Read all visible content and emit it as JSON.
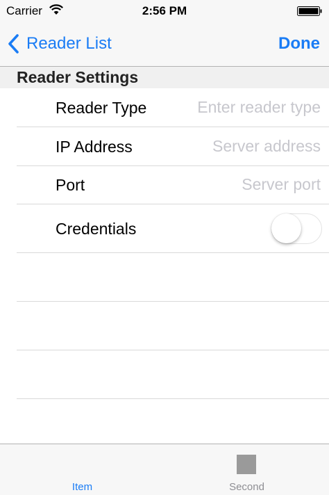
{
  "status_bar": {
    "carrier": "Carrier",
    "time": "2:56 PM"
  },
  "nav": {
    "back_label": "Reader List",
    "done_label": "Done"
  },
  "section": {
    "title": "Reader Settings"
  },
  "form": {
    "reader_type": {
      "label": "Reader Type",
      "value": "",
      "placeholder": "Enter reader type"
    },
    "ip_address": {
      "label": "IP Address",
      "value": "",
      "placeholder": "Server address"
    },
    "port": {
      "label": "Port",
      "value": "",
      "placeholder": "Server port"
    },
    "credentials": {
      "label": "Credentials",
      "enabled": false
    }
  },
  "tab_bar": {
    "tabs": [
      {
        "label": "Item",
        "selected": true
      },
      {
        "label": "Second",
        "selected": false
      }
    ]
  },
  "colors": {
    "accent": "#1a7cf5",
    "separator": "#d9d9d9",
    "placeholder": "#c7c7cd",
    "inactive_tab": "#8e8e93"
  }
}
